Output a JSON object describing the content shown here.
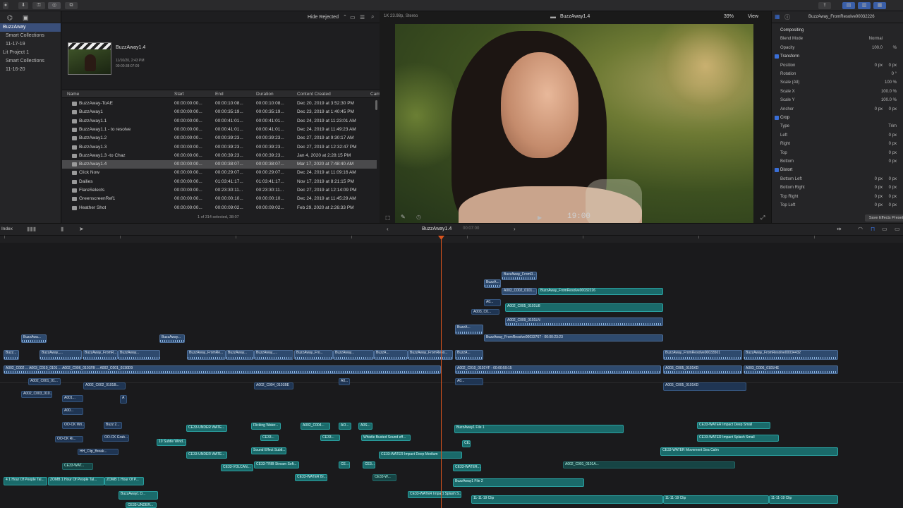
{
  "library": {
    "items": [
      {
        "label": "BuzzAway",
        "sel": true,
        "in": false
      },
      {
        "label": "Smart Collections",
        "sel": false,
        "in": true
      },
      {
        "label": "11-17-19",
        "sel": false,
        "in": true
      },
      {
        "label": "Lit Project 1",
        "sel": false,
        "in": false
      },
      {
        "label": "Smart Collections",
        "sel": false,
        "in": true
      },
      {
        "label": "11-16-20",
        "sel": false,
        "in": true
      }
    ]
  },
  "browser": {
    "filter": "Hide Rejected",
    "preview_name": "BuzzAway1.4",
    "preview_date": "11/10/20, 2:43 PM",
    "preview_dur": "00:00:38:07:09",
    "columns": [
      "Name",
      "Start",
      "End",
      "Duration",
      "Content Created",
      "Cam"
    ],
    "rows": [
      [
        "BuzzAway-ToAE",
        "00:00:00:00...",
        "00:00:10:08...",
        "00:00:10:08...",
        "Dec 20, 2019 at 3:52:30 PM"
      ],
      [
        "BuzzAway1",
        "00:00:00:00...",
        "00:00:35:19...",
        "00:00:35:19...",
        "Dec 23, 2019 at 1:40:45 PM"
      ],
      [
        "BuzzAway1.1",
        "00:00:00:00...",
        "00:00:41:01...",
        "00:00:41:01...",
        "Dec 24, 2019 at 11:23:01 AM"
      ],
      [
        "BuzzAway1.1 - to resolve",
        "00:00:00:00...",
        "00:00:41:01...",
        "00:00:41:01...",
        "Dec 24, 2019 at 11:49:23 AM"
      ],
      [
        "BuzzAway1.2",
        "00:00:00:00...",
        "00:00:39:23...",
        "00:00:39:23...",
        "Dec 27, 2019 at 9:30:17 AM"
      ],
      [
        "BuzzAway1.3",
        "00:00:00:00...",
        "00:00:39:23...",
        "00:00:39:23...",
        "Dec 27, 2019 at 12:32:47 PM"
      ],
      [
        "BuzzAway1.3 -to Chaz",
        "00:00:00:00...",
        "00:00:39:23...",
        "00:00:39:23...",
        "Jan 4, 2020 at 2:28:15 PM"
      ],
      [
        "BuzzAway1.4",
        "00:00:00:00...",
        "00:00:38:07...",
        "00:00:38:07...",
        "Mar 17, 2020 at 7:48:40 AM"
      ],
      [
        "Click Now",
        "00:00:00:00...",
        "00:00:29:07...",
        "00:00:29:07...",
        "Dec 24, 2019 at 11:09:16 AM"
      ],
      [
        "Dailies",
        "00:00:00:00...",
        "01:03:41:17...",
        "01:03:41:17...",
        "Nov 17, 2019 at 8:21:15 PM"
      ],
      [
        "FlareSelects",
        "00:00:00:00...",
        "00:23:30:11...",
        "00:23:30:11...",
        "Dec 27, 2019 at 12:14:09 PM"
      ],
      [
        "GreenscreenRef1",
        "00:00:00:00...",
        "00:00:00:10...",
        "00:00:00:10...",
        "Dec 24, 2019 at 11:45:29 AM"
      ],
      [
        "Heather Shot",
        "00:00:00:00...",
        "00:00:09:02...",
        "00:00:09:02...",
        "Feb 29, 2020 at 2:26:33 PM"
      ]
    ],
    "status": "1 of 314 selected, 38:07"
  },
  "viewer": {
    "format": "1K 23.98p, Stereo",
    "title": "BuzzAway1.4",
    "zoom": "39%",
    "view": "View",
    "timecode": "19:00"
  },
  "inspector": {
    "title": "BuzzAway_FromResolve00032226",
    "rows": [
      {
        "t": "sec",
        "lab": "Compositing"
      },
      {
        "t": "p",
        "lab": "Blend Mode",
        "v": "Normal"
      },
      {
        "t": "p",
        "lab": "Opacity",
        "v": "100.0",
        "u": "%"
      },
      {
        "t": "sec",
        "lab": "Transform",
        "chk": true
      },
      {
        "t": "p",
        "lab": "Position",
        "v": "0 px",
        "u": "0 px"
      },
      {
        "t": "p",
        "lab": "Rotation",
        "v": "",
        "u": "0 °"
      },
      {
        "t": "p",
        "lab": "Scale (All)",
        "v": "",
        "u": "100 %"
      },
      {
        "t": "p",
        "lab": "Scale X",
        "v": "",
        "u": "100.0 %"
      },
      {
        "t": "p",
        "lab": "Scale Y",
        "v": "",
        "u": "100.0 %"
      },
      {
        "t": "p",
        "lab": "Anchor",
        "v": "0 px",
        "u": "0 px"
      },
      {
        "t": "sec",
        "lab": "Crop",
        "chk": true
      },
      {
        "t": "p",
        "lab": "Type",
        "v": "",
        "u": "Trim"
      },
      {
        "t": "p",
        "lab": "Left",
        "v": "",
        "u": "0 px"
      },
      {
        "t": "p",
        "lab": "Right",
        "v": "",
        "u": "0 px"
      },
      {
        "t": "p",
        "lab": "Top",
        "v": "",
        "u": "0 px"
      },
      {
        "t": "p",
        "lab": "Bottom",
        "v": "",
        "u": "0 px"
      },
      {
        "t": "sec",
        "lab": "Distort",
        "chk": true
      },
      {
        "t": "p",
        "lab": "Bottom Left",
        "v": "0 px",
        "u": "0 px"
      },
      {
        "t": "p",
        "lab": "Bottom Right",
        "v": "0 px",
        "u": "0 px"
      },
      {
        "t": "p",
        "lab": "Top Right",
        "v": "0 px",
        "u": "0 px"
      },
      {
        "t": "p",
        "lab": "Top Left",
        "v": "0 px",
        "u": "0 px"
      }
    ],
    "save_label": "Save Effects Preset"
  },
  "timeline": {
    "index_label": "Index",
    "project": "BuzzAway1.4",
    "duration": "00:07:00",
    "clips": [
      {
        "l": 30,
        "t": 130,
        "w": 36,
        "h": 12,
        "c": "cb",
        "s": "BuzzAwa..."
      },
      {
        "l": 226,
        "t": 130,
        "w": 36,
        "h": 12,
        "c": "cb",
        "s": "BuzzAway..."
      },
      {
        "l": 5,
        "t": 152,
        "w": 22,
        "h": 14,
        "c": "cb",
        "s": "Buzz..."
      },
      {
        "l": 56,
        "t": 152,
        "w": 60,
        "h": 14,
        "c": "cb",
        "s": "BuzzAway_..."
      },
      {
        "l": 117,
        "t": 152,
        "w": 50,
        "h": 14,
        "c": "cb",
        "s": "BuzzAway_FromR..."
      },
      {
        "l": 167,
        "t": 152,
        "w": 60,
        "h": 14,
        "c": "cb",
        "s": "BuzzAway..."
      },
      {
        "l": 265,
        "t": 152,
        "w": 55,
        "h": 14,
        "c": "cb",
        "s": "BuzzAway_FromRe..."
      },
      {
        "l": 320,
        "t": 152,
        "w": 40,
        "h": 14,
        "c": "cb",
        "s": "BuzzAway..."
      },
      {
        "l": 360,
        "t": 152,
        "w": 56,
        "h": 14,
        "c": "cb",
        "s": "BuzzAway_..."
      },
      {
        "l": 417,
        "t": 152,
        "w": 55,
        "h": 14,
        "c": "cb",
        "s": "BuzzAway_Fro..."
      },
      {
        "l": 472,
        "t": 152,
        "w": 58,
        "h": 14,
        "c": "cb",
        "s": "BuzzAway..."
      },
      {
        "l": 530,
        "t": 152,
        "w": 48,
        "h": 14,
        "c": "cb",
        "s": "BuzzA..."
      },
      {
        "l": 578,
        "t": 152,
        "w": 64,
        "h": 14,
        "c": "cb",
        "s": "BuzzAway_FromReso..."
      },
      {
        "l": 645,
        "t": 152,
        "w": 40,
        "h": 14,
        "c": "cb",
        "s": "BuzzA..."
      },
      {
        "l": 940,
        "t": 152,
        "w": 112,
        "h": 14,
        "c": "cb",
        "s": "BuzzAway_FromResolve00033501"
      },
      {
        "l": 1054,
        "t": 152,
        "w": 134,
        "h": 14,
        "c": "cb",
        "s": "BuzzAway_FromResolve00034432"
      },
      {
        "l": 5,
        "t": 174,
        "w": 620,
        "h": 12,
        "c": "cb",
        "s": "A002_C002 ... A003_C010_0101 ... A002_C006_0101FB ... A002_C001_0130D9"
      },
      {
        "l": 645,
        "t": 174,
        "w": 292,
        "h": 12,
        "c": "cb",
        "s": "A002_C010_0101YF - 00:00:59:15"
      },
      {
        "l": 940,
        "t": 174,
        "w": 112,
        "h": 12,
        "c": "cb",
        "s": "A003_C005_0101KD"
      },
      {
        "l": 1054,
        "t": 174,
        "w": 134,
        "h": 12,
        "c": "cb",
        "s": "A003_C006_0101HE"
      },
      {
        "l": 40,
        "t": 192,
        "w": 46,
        "h": 10,
        "c": "cb2",
        "s": "A002_C001_01..."
      },
      {
        "l": 118,
        "t": 198,
        "w": 60,
        "h": 10,
        "c": "cb2",
        "s": "A002_C002_0101B..."
      },
      {
        "l": 360,
        "t": 198,
        "w": 56,
        "h": 10,
        "c": "cb2",
        "s": "A002_C004_0101BE"
      },
      {
        "l": 480,
        "t": 192,
        "w": 16,
        "h": 10,
        "c": "cb2",
        "s": "A0..."
      },
      {
        "l": 645,
        "t": 192,
        "w": 40,
        "h": 10,
        "c": "cb2",
        "s": "A0..."
      },
      {
        "l": 940,
        "t": 198,
        "w": 118,
        "h": 12,
        "c": "cb2",
        "s": "A003_C005_0101KD"
      },
      {
        "l": 30,
        "t": 210,
        "w": 44,
        "h": 10,
        "c": "cb2",
        "s": "A002_C003_010..."
      },
      {
        "l": 88,
        "t": 216,
        "w": 30,
        "h": 10,
        "c": "cb2",
        "s": "A001..."
      },
      {
        "l": 88,
        "t": 234,
        "w": 30,
        "h": 10,
        "c": "cb2",
        "s": "A00..."
      },
      {
        "l": 170,
        "t": 216,
        "w": 10,
        "h": 12,
        "c": "cb2",
        "s": "A"
      },
      {
        "l": 711,
        "t": 41,
        "w": 50,
        "h": 12,
        "c": "cb",
        "s": "BuzzAway_FromR..."
      },
      {
        "l": 686,
        "t": 52,
        "w": 24,
        "h": 12,
        "c": "cb",
        "s": "BuzzA..."
      },
      {
        "l": 711,
        "t": 64,
        "w": 50,
        "h": 10,
        "c": "cb",
        "s": "A002_C002_0101..."
      },
      {
        "l": 763,
        "t": 64,
        "w": 177,
        "h": 10,
        "c": "ct",
        "s": "BuzzAway_FromResolve00032226"
      },
      {
        "l": 686,
        "t": 80,
        "w": 24,
        "h": 10,
        "c": "cb2",
        "s": "A0..."
      },
      {
        "l": 716,
        "t": 86,
        "w": 224,
        "h": 12,
        "c": "ct",
        "s": "A002_C005_0101U8"
      },
      {
        "l": 668,
        "t": 94,
        "w": 40,
        "h": 8,
        "c": "cb2",
        "s": "A003_C0..."
      },
      {
        "l": 716,
        "t": 106,
        "w": 224,
        "h": 12,
        "c": "cb",
        "s": "A002_C009_0101LN"
      },
      {
        "l": 645,
        "t": 116,
        "w": 40,
        "h": 14,
        "c": "cb",
        "s": "BuzzA..."
      },
      {
        "l": 686,
        "t": 130,
        "w": 254,
        "h": 10,
        "c": "cb",
        "s": "BuzzAway_FromResolve00033767 - 00:00:23:23"
      },
      {
        "l": 88,
        "t": 254,
        "w": 32,
        "h": 10,
        "c": "cb2",
        "s": "OO-CK Wri..."
      },
      {
        "l": 147,
        "t": 254,
        "w": 26,
        "h": 10,
        "c": "cb2",
        "s": "Buzz 2..."
      },
      {
        "l": 78,
        "t": 274,
        "w": 40,
        "h": 9,
        "c": "cb2",
        "s": "OO-CK Ri..."
      },
      {
        "l": 145,
        "t": 272,
        "w": 38,
        "h": 10,
        "c": "cb2",
        "s": "OO-CK Grab..."
      },
      {
        "l": 222,
        "t": 278,
        "w": 42,
        "h": 10,
        "c": "ct",
        "s": "10 Subtle Wind..."
      },
      {
        "l": 264,
        "t": 258,
        "w": 58,
        "h": 10,
        "c": "ct",
        "s": "CE33-UNDER WATE..."
      },
      {
        "l": 264,
        "t": 296,
        "w": 58,
        "h": 10,
        "c": "ct",
        "s": "CE33-UNDER WATE..."
      },
      {
        "l": 356,
        "t": 255,
        "w": 42,
        "h": 10,
        "c": "ct",
        "s": "Flicking Water..."
      },
      {
        "l": 369,
        "t": 272,
        "w": 26,
        "h": 9,
        "c": "ct",
        "s": "CE33..."
      },
      {
        "l": 356,
        "t": 290,
        "w": 50,
        "h": 10,
        "c": "ct",
        "s": "Sound Effect Subtl..."
      },
      {
        "l": 360,
        "t": 310,
        "w": 64,
        "h": 10,
        "c": "ct",
        "s": "CE33-TRIB Stream Soft..."
      },
      {
        "l": 426,
        "t": 255,
        "w": 42,
        "h": 10,
        "c": "ct",
        "s": "A002_C004..."
      },
      {
        "l": 454,
        "t": 272,
        "w": 28,
        "h": 9,
        "c": "ct",
        "s": "CE33..."
      },
      {
        "l": 480,
        "t": 255,
        "w": 18,
        "h": 10,
        "c": "ct",
        "s": "AO..."
      },
      {
        "l": 508,
        "t": 255,
        "w": 20,
        "h": 10,
        "c": "ct",
        "s": "A0S..."
      },
      {
        "l": 512,
        "t": 272,
        "w": 70,
        "h": 9,
        "c": "ct",
        "s": "Whistle Busted Sound eff..."
      },
      {
        "l": 537,
        "t": 296,
        "w": 118,
        "h": 10,
        "c": "ct",
        "s": "CE33-WATER Impact Deep Medium"
      },
      {
        "l": 313,
        "t": 314,
        "w": 46,
        "h": 10,
        "c": "ct",
        "s": "CE33-VOLCAN..."
      },
      {
        "l": 418,
        "t": 328,
        "w": 46,
        "h": 10,
        "c": "ct",
        "s": "CE33-WATER Br..."
      },
      {
        "l": 480,
        "t": 310,
        "w": 16,
        "h": 10,
        "c": "ct",
        "s": "CE..."
      },
      {
        "l": 514,
        "t": 310,
        "w": 18,
        "h": 10,
        "c": "ct",
        "s": "CE3..."
      },
      {
        "l": 528,
        "t": 328,
        "w": 34,
        "h": 10,
        "c": "ctd",
        "s": "CE33-W..."
      },
      {
        "l": 644,
        "t": 258,
        "w": 240,
        "h": 12,
        "c": "ct",
        "s": "BuzzAway1 File 1"
      },
      {
        "l": 655,
        "t": 280,
        "w": 12,
        "h": 10,
        "c": "ct",
        "s": "CE3"
      },
      {
        "l": 642,
        "t": 314,
        "w": 40,
        "h": 10,
        "c": "ct",
        "s": "CE33-WATER..."
      },
      {
        "l": 642,
        "t": 334,
        "w": 186,
        "h": 12,
        "c": "ct",
        "s": "BuzzAway1 File 2"
      },
      {
        "l": 578,
        "t": 352,
        "w": 76,
        "h": 10,
        "c": "ct",
        "s": "CE33-WATER Impact Splash S..."
      },
      {
        "l": 668,
        "t": 358,
        "w": 272,
        "h": 12,
        "c": "ct",
        "s": "11-11-19 Clip"
      },
      {
        "l": 940,
        "t": 358,
        "w": 150,
        "h": 12,
        "c": "ct",
        "s": "11-11-19 Clip"
      },
      {
        "l": 1090,
        "t": 358,
        "w": 98,
        "h": 12,
        "c": "ct",
        "s": "11-11-19 Clip"
      },
      {
        "l": 988,
        "t": 254,
        "w": 104,
        "h": 10,
        "c": "ct",
        "s": "CE33-WATER Impact Deep Small"
      },
      {
        "l": 988,
        "t": 272,
        "w": 116,
        "h": 10,
        "c": "ct",
        "s": "CE33-WATER Impact Splash Small"
      },
      {
        "l": 936,
        "t": 290,
        "w": 252,
        "h": 12,
        "c": "ct",
        "s": "CE33-WATER Movement Sea Calm"
      },
      {
        "l": 798,
        "t": 310,
        "w": 244,
        "h": 10,
        "c": "ctd",
        "s": "A002_C001_0101A..."
      },
      {
        "l": 5,
        "t": 332,
        "w": 62,
        "h": 12,
        "c": "ct",
        "s": "4 1 Hour Of People Tal..."
      },
      {
        "l": 68,
        "t": 332,
        "w": 80,
        "h": 12,
        "c": "ct",
        "s": "ZOMB 1 Hour Of People Tal..."
      },
      {
        "l": 148,
        "t": 332,
        "w": 56,
        "h": 12,
        "c": "ct",
        "s": "ZOMB 1 Hour Of P..."
      },
      {
        "l": 88,
        "t": 312,
        "w": 44,
        "h": 10,
        "c": "ctd",
        "s": "CE33-WAT..."
      },
      {
        "l": 168,
        "t": 352,
        "w": 56,
        "h": 12,
        "c": "ct",
        "s": "BuzzAway1 D..."
      },
      {
        "l": 178,
        "t": 368,
        "w": 44,
        "h": 8,
        "c": "ct",
        "s": "CE33-UNDER..."
      },
      {
        "l": 110,
        "t": 292,
        "w": 58,
        "h": 9,
        "c": "cb2",
        "s": "HH_Clip_Break..."
      }
    ]
  }
}
